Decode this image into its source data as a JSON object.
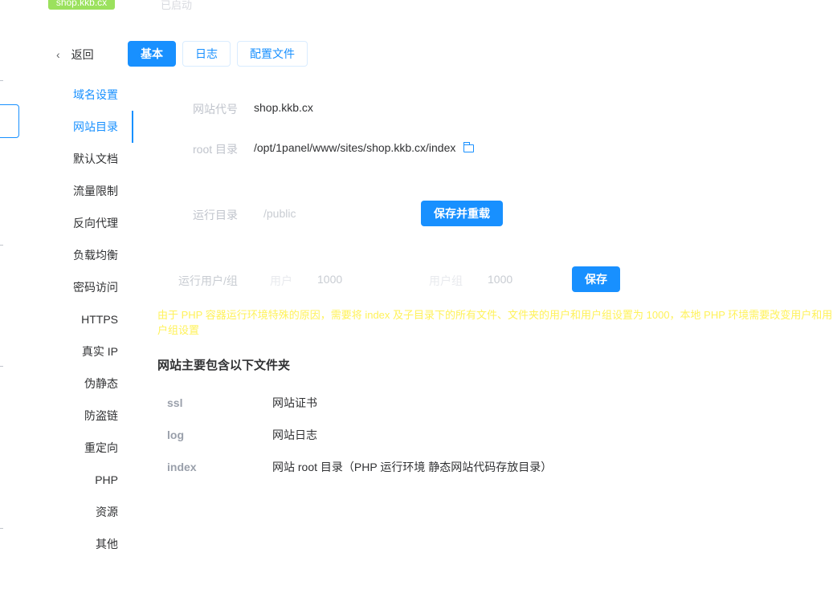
{
  "top": {
    "tag": "shop.kkb.cx",
    "faded_text": "已启动"
  },
  "back_label": "返回",
  "tabs": [
    {
      "label": "基本",
      "active": true
    },
    {
      "label": "日志",
      "active": false
    },
    {
      "label": "配置文件",
      "active": false
    }
  ],
  "sidebar": {
    "items": [
      {
        "label": "域名设置"
      },
      {
        "label": "网站目录"
      },
      {
        "label": "默认文档"
      },
      {
        "label": "流量限制"
      },
      {
        "label": "反向代理"
      },
      {
        "label": "负载均衡"
      },
      {
        "label": "密码访问"
      },
      {
        "label": "HTTPS"
      },
      {
        "label": "真实 IP"
      },
      {
        "label": "伪静态"
      },
      {
        "label": "防盗链"
      },
      {
        "label": "重定向"
      },
      {
        "label": "PHP"
      },
      {
        "label": "资源"
      },
      {
        "label": "其他"
      }
    ]
  },
  "form": {
    "site_code_label": "网站代号",
    "site_code_value": "shop.kkb.cx",
    "root_label": "root 目录",
    "root_value": "/opt/1panel/www/sites/shop.kkb.cx/index",
    "run_dir_label": "运行目录",
    "run_dir_value": "/public",
    "save_reload_label": "保存并重载",
    "run_user_label": "运行用户/组",
    "user_label": "用户",
    "user_value": "1000",
    "group_label": "用户组",
    "group_value": "1000",
    "save_label": "保存"
  },
  "notice": "由于 PHP 容器运行环境特殊的原因，需要将 index 及子目录下的所有文件、文件夹的用户和用户组设置为 1000，本地 PHP 环境需要改变用户和用户组设置",
  "folders": {
    "title": "网站主要包含以下文件夹",
    "items": [
      {
        "name": "ssl",
        "desc": "网站证书"
      },
      {
        "name": "log",
        "desc": "网站日志"
      },
      {
        "name": "index",
        "desc": "网站 root 目录（PHP 运行环境 静态网站代码存放目录）"
      }
    ]
  },
  "colors": {
    "accent": "#1890ff",
    "tag_green": "#9be15d",
    "notice_yellow": "#fff25a"
  }
}
